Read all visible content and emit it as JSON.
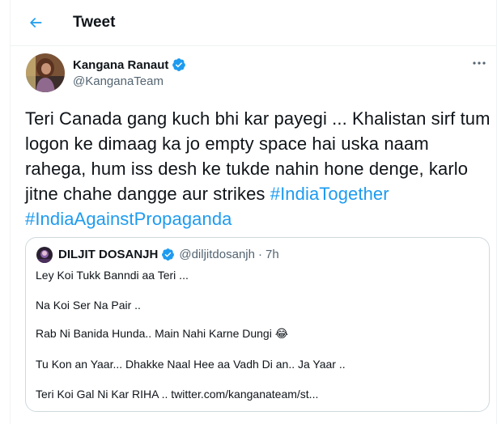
{
  "header": {
    "title": "Tweet"
  },
  "author": {
    "name": "Kangana Ranaut",
    "handle": "@KanganaTeam",
    "verified": true
  },
  "tweet": {
    "text_plain": "Teri Canada gang kuch bhi kar payegi ... Khalistan sirf tum logon ke dimaag ka jo empty space hai uska naam rahega, hum iss desh ke tukde nahin hone denge, karlo jitne chahe dangge aur strikes ",
    "hashtag_1": "#IndiaTogether",
    "hashtag_2": "#IndiaAgainstPropaganda"
  },
  "quoted_tweet": {
    "name": "DILJIT DOSANJH",
    "handle": "@diljitdosanjh",
    "separator": "·",
    "time": "7h",
    "verified": true,
    "lines": [
      "Ley Koi Tukk Banndi aa Teri ...",
      "Na Koi Ser Na Pair ..",
      "Rab Ni Banida Hunda.. Main Nahi Karne Dungi 😂",
      "Tu Kon an Yaar... Dhakke Naal Hee aa Vadh Di an.. Ja Yaar ..",
      "Teri Koi Gal Ni Kar RIHA .. twitter.com/kanganateam/st..."
    ]
  },
  "colors": {
    "accent": "#1d9bf0",
    "text_primary": "#0f1419",
    "text_secondary": "#536471",
    "border": "#cfd9de"
  },
  "icons": {
    "back": "arrow-left-icon",
    "verified": "verified-badge-icon",
    "more": "more-horizontal-icon"
  }
}
